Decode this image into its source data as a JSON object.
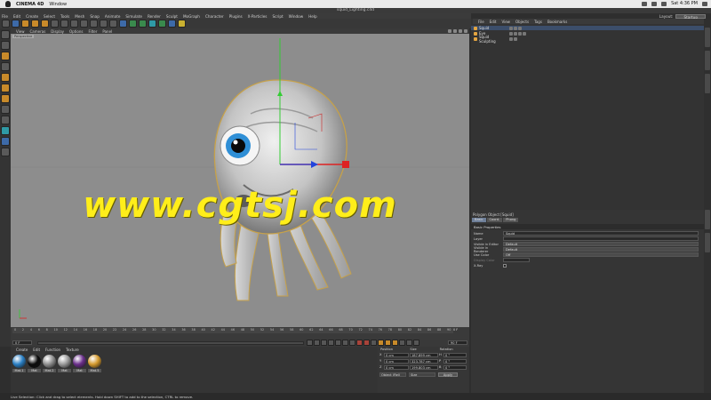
{
  "os_menubar": {
    "app": "CINEMA 4D",
    "menu": "Window",
    "clock": "Sat 4:36 PM"
  },
  "window": {
    "title": "squid_Lighting.c4d"
  },
  "main_menu": [
    "File",
    "Edit",
    "Create",
    "Select",
    "Tools",
    "Mesh",
    "Snap",
    "Animate",
    "Simulate",
    "Render",
    "Sculpt",
    "MoGraph",
    "Character",
    "Plugins",
    "X-Particles",
    "Script",
    "Window",
    "Help"
  ],
  "layout": {
    "label": "Layout:",
    "value": "Startup"
  },
  "viewport": {
    "menu": [
      "View",
      "Cameras",
      "Display",
      "Options",
      "Filter",
      "Panel"
    ],
    "label": "Perspective",
    "watermark": "www.cgtsj.com"
  },
  "timeline": {
    "ticks": [
      "0",
      "2",
      "4",
      "6",
      "8",
      "10",
      "12",
      "14",
      "16",
      "18",
      "20",
      "22",
      "24",
      "26",
      "28",
      "30",
      "32",
      "34",
      "36",
      "38",
      "40",
      "42",
      "44",
      "46",
      "48",
      "50",
      "52",
      "54",
      "56",
      "58",
      "60",
      "62",
      "64",
      "66",
      "68",
      "70",
      "72",
      "74",
      "76",
      "78",
      "80",
      "82",
      "84",
      "86",
      "88",
      "90"
    ],
    "current_frame": "0 F",
    "start": "0 F",
    "end": "90 F"
  },
  "material_manager": {
    "menu": [
      "Create",
      "Edit",
      "Function",
      "Texture"
    ],
    "materials": [
      {
        "label": "Mat.1",
        "color": "#2a7fc4"
      },
      {
        "label": "Mat",
        "color": "#0b0b0b"
      },
      {
        "label": "Mat.2",
        "color": "#8f8f8f"
      },
      {
        "label": "Mat",
        "color": "#9a9a9a"
      },
      {
        "label": "Mat",
        "color": "#6a2f8a"
      },
      {
        "label": "Mat.5",
        "color": "#d49a2e"
      }
    ]
  },
  "coordinates": {
    "headers": [
      "Position",
      "Size",
      "Rotation"
    ],
    "rows": [
      {
        "axis": "X",
        "pos": "0 cm",
        "size": "187.899 cm",
        "rot_axis": "H",
        "rot": "0 °"
      },
      {
        "axis": "Y",
        "pos": "0 cm",
        "size": "323.787 cm",
        "rot_axis": "P",
        "rot": "0 °"
      },
      {
        "axis": "Z",
        "pos": "0 cm",
        "size": "199.803 cm",
        "rot_axis": "B",
        "rot": "0 °"
      }
    ],
    "mode": "Object (Rel)",
    "size_mode": "Size",
    "apply": "Apply"
  },
  "object_manager": {
    "menu": [
      "File",
      "Edit",
      "View",
      "Objects",
      "Tags",
      "Bookmarks"
    ],
    "objects": [
      {
        "name": "Squid"
      },
      {
        "name": "Eye"
      },
      {
        "name": "Squid Sculpting"
      }
    ]
  },
  "attribute_manager": {
    "header": "Polygon Object [Squid]",
    "tabs": [
      "Basic",
      "Coord.",
      "Phong"
    ],
    "section": "Basic Properties",
    "rows": [
      {
        "label": "Name",
        "value": "Squid"
      },
      {
        "label": "Layer",
        "value": ""
      },
      {
        "label": "Visible in Editor",
        "value": "Default"
      },
      {
        "label": "Visible in Renderer",
        "value": "Default"
      },
      {
        "label": "Use Color",
        "value": "Off"
      },
      {
        "label": "Display Color",
        "value": ""
      },
      {
        "label": "X-Ray",
        "value": ""
      }
    ]
  },
  "status": "Live Selection: Click and drag to select elements. Hold down SHIFT to add to the selection, CTRL to remove."
}
